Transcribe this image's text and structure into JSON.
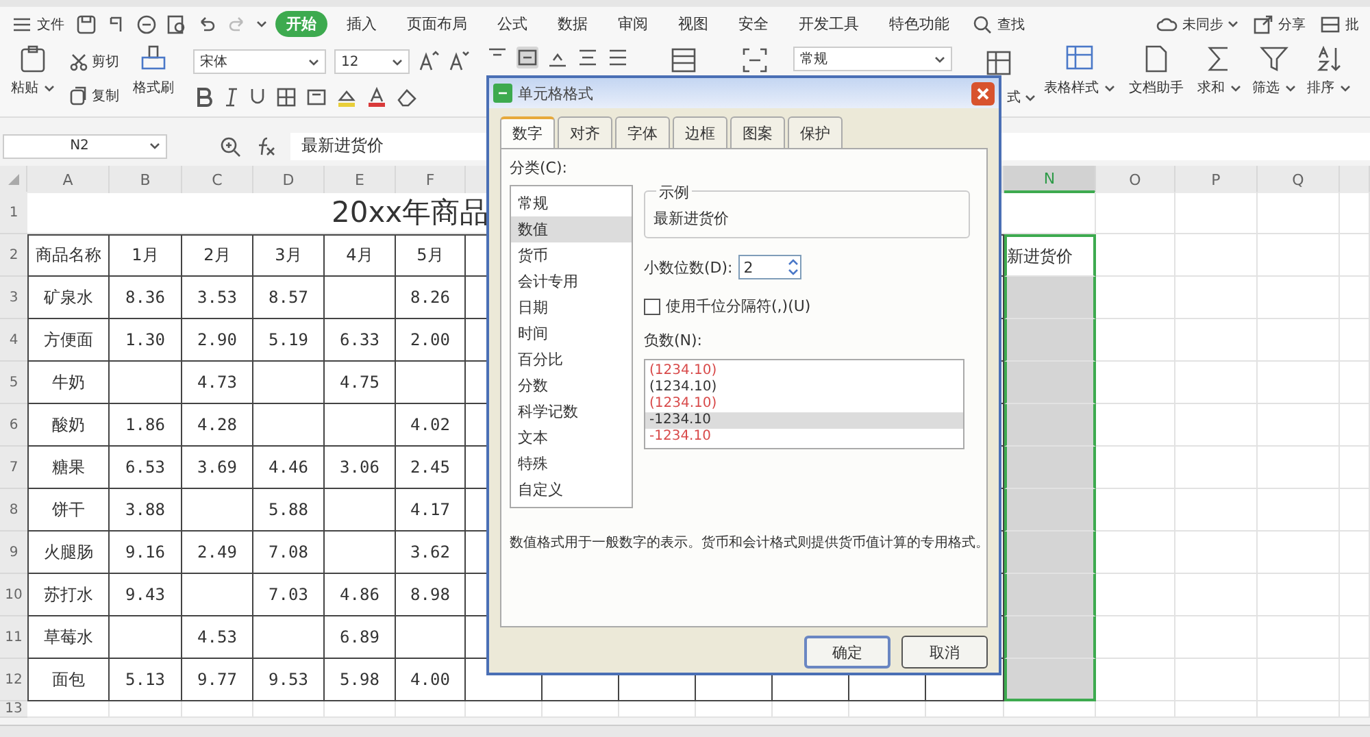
{
  "menu": {
    "file": "文件",
    "tabs": [
      {
        "label": "开始",
        "selected": true
      },
      {
        "label": "插入",
        "selected": false
      },
      {
        "label": "页面布局",
        "selected": false
      },
      {
        "label": "公式",
        "selected": false
      },
      {
        "label": "数据",
        "selected": false
      },
      {
        "label": "审阅",
        "selected": false
      },
      {
        "label": "视图",
        "selected": false
      },
      {
        "label": "安全",
        "selected": false
      },
      {
        "label": "开发工具",
        "selected": false
      },
      {
        "label": "特色功能",
        "selected": false
      }
    ],
    "search": "查找",
    "sync": "未同步",
    "share": "分享",
    "comment": "批"
  },
  "ribbon": {
    "paste": "粘贴",
    "cut": "剪切",
    "copy": "复制",
    "format_painter": "格式刷",
    "font": "宋体",
    "size": "12",
    "number_format": "常规",
    "conditional_format": "式",
    "table_style": "表格样式",
    "doc_helper": "文档助手",
    "sum": "求和",
    "filter": "筛选",
    "sort": "排序"
  },
  "formula_bar": {
    "name_box": "N2",
    "formula": "最新进货价"
  },
  "sheet": {
    "columns_left": [
      {
        "label": "A",
        "selected": false
      },
      {
        "label": "B",
        "selected": false
      },
      {
        "label": "C",
        "selected": false
      },
      {
        "label": "D",
        "selected": false
      },
      {
        "label": "E",
        "selected": false
      },
      {
        "label": "F",
        "selected": false
      }
    ],
    "columns_right": [
      {
        "label": "N",
        "selected": true
      },
      {
        "label": "O",
        "selected": false
      },
      {
        "label": "P",
        "selected": false
      },
      {
        "label": "Q",
        "selected": false
      }
    ],
    "row_numbers": [
      "1",
      "2",
      "3",
      "4",
      "5",
      "6",
      "7",
      "8",
      "9",
      "10",
      "11",
      "12",
      "13"
    ],
    "title": "20xx年商品",
    "header": [
      "商品名称",
      "1月",
      "2月",
      "3月",
      "4月",
      "5月"
    ],
    "n_header": "新进货价",
    "rows": [
      [
        "矿泉水",
        "8.36",
        "3.53",
        "8.57",
        "",
        "8.26"
      ],
      [
        "方便面",
        "1.30",
        "2.90",
        "5.19",
        "6.33",
        "2.00"
      ],
      [
        "牛奶",
        "",
        "4.73",
        "",
        "4.75",
        ""
      ],
      [
        "酸奶",
        "1.86",
        "4.28",
        "",
        "",
        "4.02"
      ],
      [
        "糖果",
        "6.53",
        "3.69",
        "4.46",
        "3.06",
        "2.45"
      ],
      [
        "饼干",
        "3.88",
        "",
        "5.88",
        "",
        "4.17"
      ],
      [
        "火腿肠",
        "9.16",
        "2.49",
        "7.08",
        "",
        "3.62"
      ],
      [
        "苏打水",
        "9.43",
        "",
        "7.03",
        "4.86",
        "8.98"
      ],
      [
        "草莓水",
        "",
        "4.53",
        "",
        "6.89",
        ""
      ],
      [
        "面包",
        "5.13",
        "9.77",
        "9.53",
        "5.98",
        "4.00"
      ]
    ]
  },
  "dialog": {
    "title": "单元格格式",
    "tabs": [
      {
        "label": "数字",
        "selected": true
      },
      {
        "label": "对齐",
        "selected": false
      },
      {
        "label": "字体",
        "selected": false
      },
      {
        "label": "边框",
        "selected": false
      },
      {
        "label": "图案",
        "selected": false
      },
      {
        "label": "保护",
        "selected": false
      }
    ],
    "category_label": "分类(C):",
    "categories": [
      {
        "label": "常规",
        "selected": false
      },
      {
        "label": "数值",
        "selected": true
      },
      {
        "label": "货币",
        "selected": false
      },
      {
        "label": "会计专用",
        "selected": false
      },
      {
        "label": "日期",
        "selected": false
      },
      {
        "label": "时间",
        "selected": false
      },
      {
        "label": "百分比",
        "selected": false
      },
      {
        "label": "分数",
        "selected": false
      },
      {
        "label": "科学记数",
        "selected": false
      },
      {
        "label": "文本",
        "selected": false
      },
      {
        "label": "特殊",
        "selected": false
      },
      {
        "label": "自定义",
        "selected": false
      }
    ],
    "sample_label": "示例",
    "sample": "最新进货价",
    "decimal_label": "小数位数(D):",
    "decimals": "2",
    "thousands": {
      "label": "使用千位分隔符(,)(U)",
      "checked": false
    },
    "negative_label": "负数(N):",
    "negatives": [
      {
        "text": "(1234.10)",
        "color": "#d84a4a",
        "selected": false
      },
      {
        "text": "(1234.10)",
        "color": "#333333",
        "selected": false
      },
      {
        "text": "(1234.10)",
        "color": "#d84a4a",
        "selected": false
      },
      {
        "text": "-1234.10",
        "color": "#333333",
        "selected": true
      },
      {
        "text": "-1234.10",
        "color": "#d84a4a",
        "selected": false
      }
    ],
    "description": "数值格式用于一般数字的表示。货币和会计格式则提供货币值计算的专用格式。",
    "buttons": [
      "确定",
      "取消"
    ]
  }
}
